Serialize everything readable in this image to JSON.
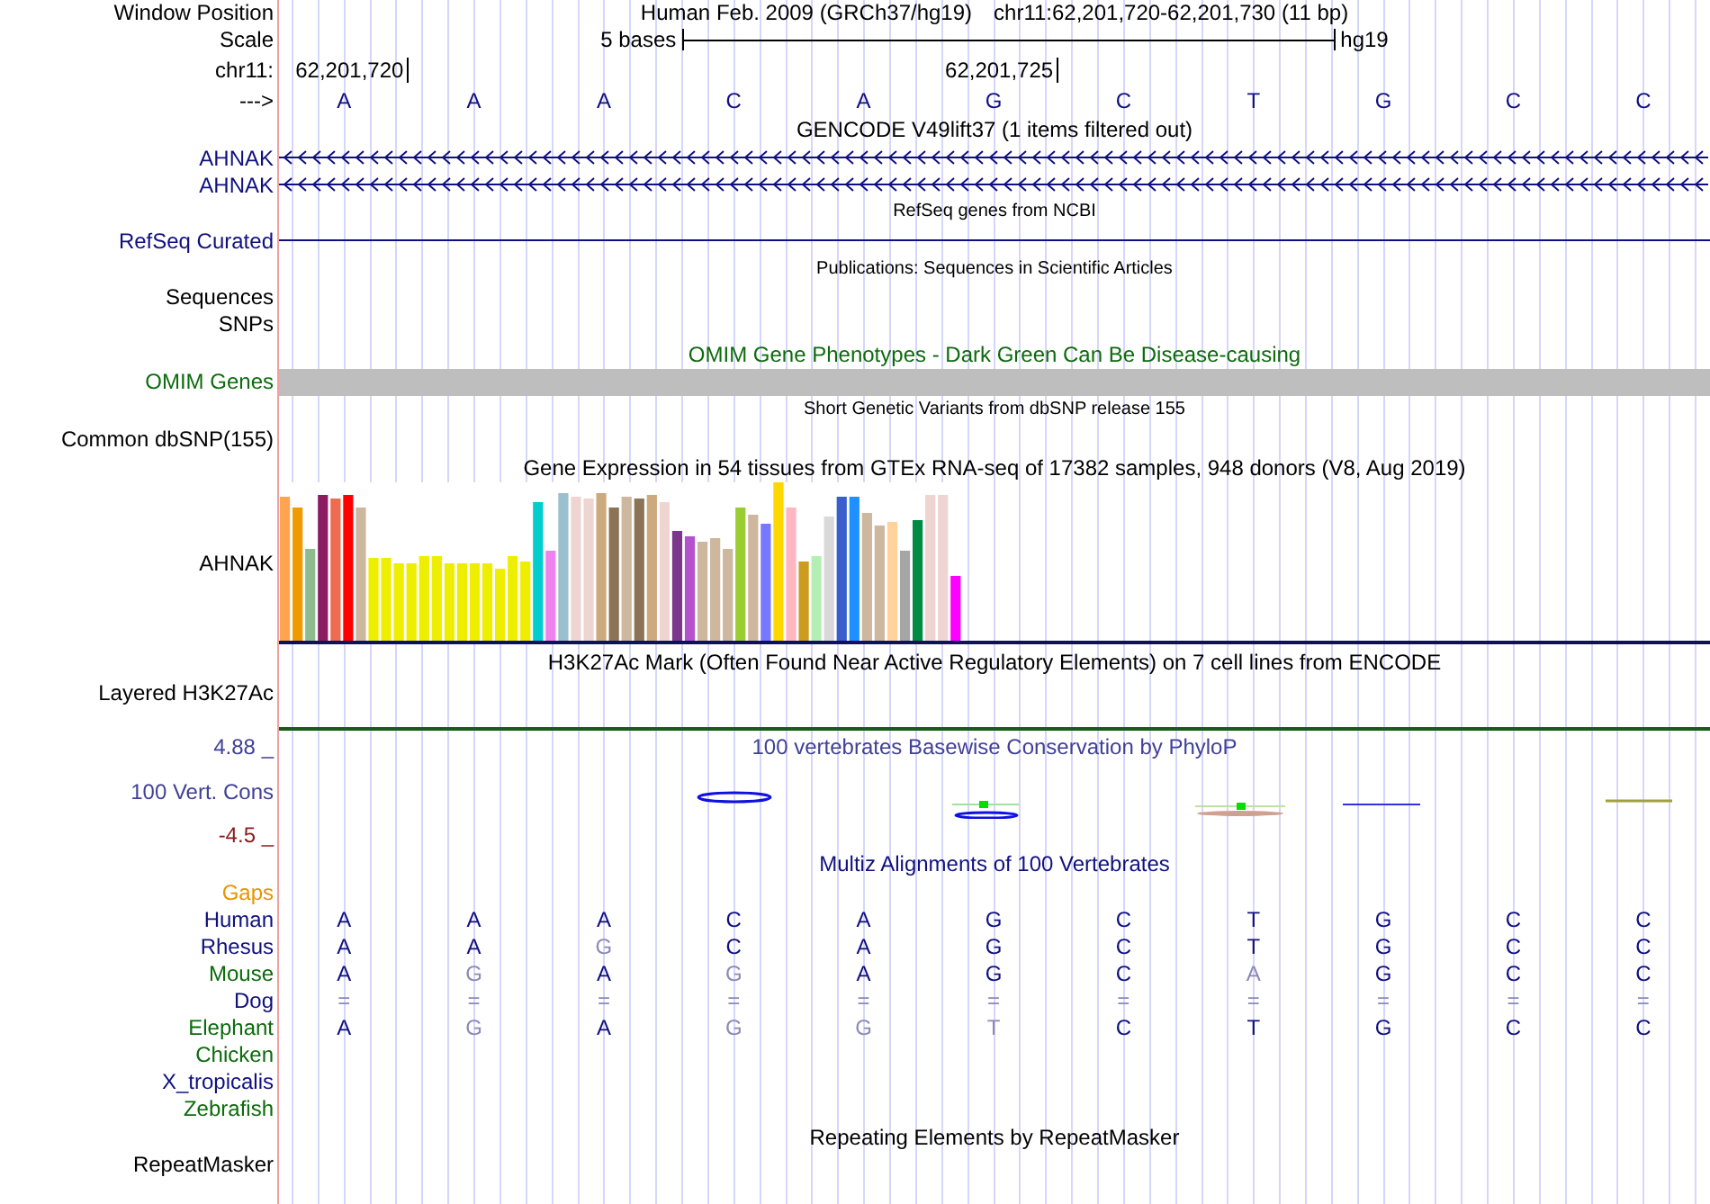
{
  "position": {
    "label": "Window Position",
    "assembly": "Human Feb. 2009 (GRCh37/hg19)",
    "range": "chr11:62,201,720-62,201,730 (11 bp)"
  },
  "scale": {
    "label": "Scale",
    "length": "5 bases",
    "assembly": "hg19"
  },
  "coordinates": {
    "label": "chr11:",
    "ticks": [
      "62,201,720",
      "62,201,725"
    ]
  },
  "sequence": {
    "label": "--->",
    "bases": [
      "A",
      "A",
      "A",
      "C",
      "A",
      "G",
      "C",
      "T",
      "G",
      "C",
      "C"
    ]
  },
  "gencode": {
    "title": "GENCODE V49lift37 (1 items filtered out)",
    "genes": [
      "AHNAK",
      "AHNAK"
    ]
  },
  "refseq": {
    "title": "RefSeq genes from NCBI",
    "label": "RefSeq Curated"
  },
  "publications": {
    "title": "Publications: Sequences in Scientific Articles",
    "labels": [
      "Sequences",
      "SNPs"
    ]
  },
  "omim": {
    "title": "OMIM Gene Phenotypes - Dark Green Can Be Disease-causing",
    "label": "OMIM Genes"
  },
  "dbsnp": {
    "title": "Short Genetic Variants from dbSNP release 155",
    "label": "Common dbSNP(155)"
  },
  "gtex": {
    "title": "Gene Expression in 54 tissues from GTEx RNA-seq of 17382 samples, 948 donors (V8, Aug 2019)",
    "label": "AHNAK"
  },
  "h3k27ac": {
    "title": "H3K27Ac Mark (Often Found Near Active Regulatory Elements) on 7 cell lines from ENCODE",
    "label": "Layered H3K27Ac"
  },
  "phylop": {
    "title": "100 vertebrates Basewise Conservation by PhyloP",
    "label": "100 Vert. Cons",
    "max": "4.88 _",
    "min": "-4.5 _"
  },
  "multiz": {
    "title": "Multiz Alignments of 100 Vertebrates",
    "gaps_label": "Gaps",
    "species": [
      {
        "name": "Human",
        "color": "#101080",
        "bases": [
          {
            "base": "A",
            "match": true
          },
          {
            "base": "A",
            "match": true
          },
          {
            "base": "A",
            "match": true
          },
          {
            "base": "C",
            "match": true
          },
          {
            "base": "A",
            "match": true
          },
          {
            "base": "G",
            "match": true
          },
          {
            "base": "C",
            "match": true
          },
          {
            "base": "T",
            "match": true
          },
          {
            "base": "G",
            "match": true
          },
          {
            "base": "C",
            "match": true
          },
          {
            "base": "C",
            "match": true
          }
        ]
      },
      {
        "name": "Rhesus",
        "color": "#101080",
        "bases": [
          {
            "base": "A",
            "match": true
          },
          {
            "base": "A",
            "match": true
          },
          {
            "base": "G",
            "match": false
          },
          {
            "base": "C",
            "match": true
          },
          {
            "base": "A",
            "match": true
          },
          {
            "base": "G",
            "match": true
          },
          {
            "base": "C",
            "match": true
          },
          {
            "base": "T",
            "match": true
          },
          {
            "base": "G",
            "match": true
          },
          {
            "base": "C",
            "match": true
          },
          {
            "base": "C",
            "match": true
          }
        ]
      },
      {
        "name": "Mouse",
        "color": "#0c6b0c",
        "bases": [
          {
            "base": "A",
            "match": true
          },
          {
            "base": "G",
            "match": false
          },
          {
            "base": "A",
            "match": true
          },
          {
            "base": "G",
            "match": false
          },
          {
            "base": "A",
            "match": true
          },
          {
            "base": "G",
            "match": true
          },
          {
            "base": "C",
            "match": true
          },
          {
            "base": "A",
            "match": false
          },
          {
            "base": "G",
            "match": true
          },
          {
            "base": "C",
            "match": true
          },
          {
            "base": "C",
            "match": true
          }
        ]
      },
      {
        "name": "Dog",
        "color": "#101080",
        "bases": [
          {
            "base": "=",
            "match": false
          },
          {
            "base": "=",
            "match": false
          },
          {
            "base": "=",
            "match": false
          },
          {
            "base": "=",
            "match": false
          },
          {
            "base": "=",
            "match": false
          },
          {
            "base": "=",
            "match": false
          },
          {
            "base": "=",
            "match": false
          },
          {
            "base": "=",
            "match": false
          },
          {
            "base": "=",
            "match": false
          },
          {
            "base": "=",
            "match": false
          },
          {
            "base": "=",
            "match": false
          }
        ]
      },
      {
        "name": "Elephant",
        "color": "#0c6b0c",
        "bases": [
          {
            "base": "A",
            "match": true
          },
          {
            "base": "G",
            "match": false
          },
          {
            "base": "A",
            "match": true
          },
          {
            "base": "G",
            "match": false
          },
          {
            "base": "G",
            "match": false
          },
          {
            "base": "T",
            "match": false
          },
          {
            "base": "C",
            "match": true
          },
          {
            "base": "T",
            "match": true
          },
          {
            "base": "G",
            "match": true
          },
          {
            "base": "C",
            "match": true
          },
          {
            "base": "C",
            "match": true
          }
        ]
      },
      {
        "name": "Chicken",
        "color": "#0c6b0c"
      },
      {
        "name": "X_tropicalis",
        "color": "#101080"
      },
      {
        "name": "Zebrafish",
        "color": "#0c6b0c"
      }
    ]
  },
  "repeatmasker": {
    "title": "Repeating Elements by RepeatMasker",
    "label": "RepeatMasker"
  }
}
